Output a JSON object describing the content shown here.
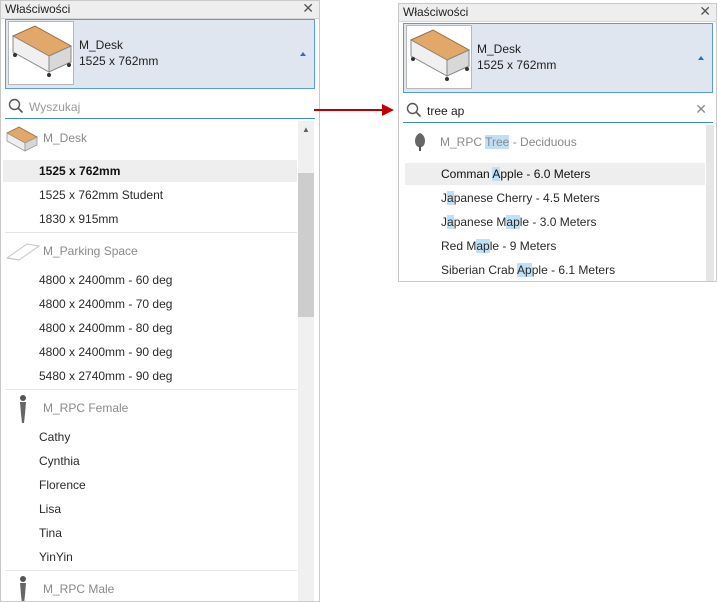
{
  "left_panel": {
    "title": "Właściwości",
    "type_selector": {
      "name": "M_Desk",
      "size": "1525 x 762mm"
    },
    "search": {
      "placeholder": "Wyszukaj",
      "value": ""
    },
    "groups": [
      {
        "family": "M_Desk",
        "icon": "desk-icon",
        "types": [
          "1525 x 762mm",
          "1525 x 762mm Student",
          "1830 x 915mm"
        ]
      },
      {
        "family": "M_Parking Space",
        "icon": "parking-space-icon",
        "types": [
          "4800 x 2400mm - 60 deg",
          "4800 x 2400mm - 70 deg",
          "4800 x 2400mm - 80 deg",
          "4800 x 2400mm - 90 deg",
          "5480 x 2740mm - 90 deg"
        ]
      },
      {
        "family": "M_RPC Female",
        "icon": "person-icon",
        "types": [
          "Cathy",
          "Cynthia",
          "Florence",
          "Lisa",
          "Tina",
          "YinYin"
        ]
      },
      {
        "family": "M_RPC Male",
        "icon": "person-icon",
        "types": []
      }
    ],
    "selected_type": "1525 x 762mm"
  },
  "right_panel": {
    "title": "Właściwości",
    "type_selector": {
      "name": "M_Desk",
      "size": "1525 x 762mm"
    },
    "search": {
      "placeholder": "Wyszukaj",
      "value": "tree ap"
    },
    "group": {
      "family_parts": [
        "M_RPC ",
        "Tree",
        " - Deciduous"
      ],
      "icon": "tree-icon",
      "types": [
        [
          "Comman ",
          "A",
          "pple - 6.0 Meters"
        ],
        [
          "J",
          "a",
          "panese Cherry - 4.5 Meters"
        ],
        [
          "J",
          "a",
          "panese M",
          "ap",
          "le - 3.0 Meters"
        ],
        [
          "Red M",
          "ap",
          "le - 9 Meters"
        ],
        [
          "Siberian Crab ",
          "Ap",
          "ple - 6.1 Meters"
        ]
      ]
    },
    "selected_index": 0
  },
  "colors": {
    "accent": "#3d88d2",
    "highlight": "#bfe0f7",
    "arrow": "#c00000"
  }
}
